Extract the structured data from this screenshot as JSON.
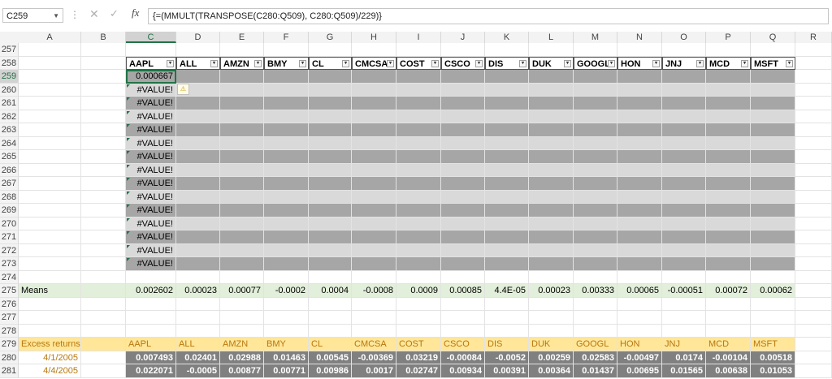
{
  "formula_bar": {
    "name_box": "C259",
    "formula": "{=(MMULT(TRANSPOSE(C280:Q509), C280:Q509)/229)}"
  },
  "columns": [
    "A",
    "B",
    "C",
    "D",
    "E",
    "F",
    "G",
    "H",
    "I",
    "J",
    "K",
    "L",
    "M",
    "N",
    "O",
    "P",
    "Q",
    "R"
  ],
  "tickers": [
    "AAPL",
    "ALL",
    "AMZN",
    "BMY",
    "CL",
    "CMCSA",
    "COST",
    "CSCO",
    "DIS",
    "DUK",
    "GOOGL",
    "HON",
    "JNJ",
    "MCD",
    "MSFT"
  ],
  "matrix": {
    "first_value": "0.000667",
    "error_value": "#VALUE!",
    "row_numbers": [
      "259",
      "260",
      "261",
      "262",
      "263",
      "264",
      "265",
      "266",
      "267",
      "268",
      "269",
      "270",
      "271",
      "272",
      "273"
    ]
  },
  "blank_rows": [
    "274",
    "276",
    "277",
    "278"
  ],
  "header_row_number": "258",
  "blank_row_257": "257",
  "means": {
    "row_number": "275",
    "label": "Means",
    "values": [
      "0.002602",
      "0.00023",
      "0.00077",
      "-0.0002",
      "0.0004",
      "-0.0008",
      "0.0009",
      "0.00085",
      "4.4E-05",
      "0.00023",
      "0.00333",
      "0.00065",
      "-0.00051",
      "0.00072",
      "0.00062"
    ]
  },
  "excess": {
    "row_number": "279",
    "label": "Excess returns",
    "rows": [
      {
        "row_number": "280",
        "date": "4/1/2005",
        "values": [
          "0.007493",
          "0.02401",
          "0.02988",
          "0.01463",
          "0.00545",
          "-0.00369",
          "0.03219",
          "-0.00084",
          "-0.0052",
          "0.00259",
          "0.02583",
          "-0.00497",
          "0.0174",
          "-0.00104",
          "0.00518"
        ]
      },
      {
        "row_number": "281",
        "date": "4/4/2005",
        "values": [
          "0.022071",
          "-0.0005",
          "0.00877",
          "0.00771",
          "0.00986",
          "0.0017",
          "0.02747",
          "0.00934",
          "0.00391",
          "0.00364",
          "0.01437",
          "0.00695",
          "0.01565",
          "0.00638",
          "0.01053"
        ]
      }
    ]
  }
}
